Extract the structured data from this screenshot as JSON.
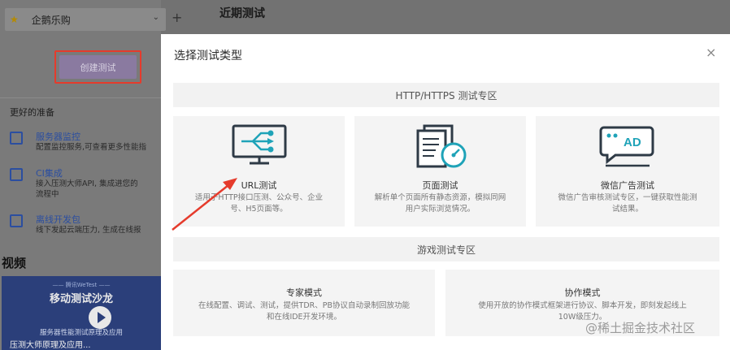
{
  "sidebar": {
    "project_name": "企鹅乐购",
    "create_button": "创建测试",
    "prep_title": "更好的准备",
    "tools": [
      {
        "title": "服务器监控",
        "desc": "配置监控服务,可查看更多性能指"
      },
      {
        "title": "CI集成",
        "desc_lines": [
          "接入压测大师API, 集成进您的",
          "流程中"
        ]
      },
      {
        "title": "离线开发包",
        "desc": "线下发起云端压力, 生成在线报"
      }
    ],
    "video_section_title": "视频",
    "video": {
      "top_caption": "——  腾讯WeTest  ——",
      "title": "移动测试沙龙",
      "caption": "服务器性能测试原理及应用",
      "bottom_text": "压测大师原理及应用..."
    }
  },
  "header": {
    "recent_title": "近期测试",
    "plus": "+"
  },
  "modal": {
    "title": "选择测试类型",
    "close": "×",
    "http_zone": "HTTP/HTTPS 测试专区",
    "game_zone": "游戏测试专区",
    "http_cards": [
      {
        "title": "URL测试",
        "desc_lines": [
          "适用于HTTP接口压测、公众号、企业",
          "号、H5页面等。"
        ]
      },
      {
        "title": "页面测试",
        "desc_lines": [
          "解析单个页面所有静态资源，模拟同网",
          "用户实际浏览情况。"
        ]
      },
      {
        "title": "微信广告测试",
        "desc_lines": [
          "微信广告审核测试专区，一键获取性能测",
          "试结果。"
        ]
      }
    ],
    "game_cards": [
      {
        "title": "专家模式",
        "desc_lines": [
          "在线配置、调试、测试，提供TDR、PB协议自动录制回放功能",
          "和在线IDE开发环境。"
        ]
      },
      {
        "title": "协作模式",
        "desc_lines": [
          "使用开放的协作模式框架进行协议、脚本开发，即刻发起线上",
          "10W级压力。"
        ]
      }
    ],
    "ad_icon_text": "AD"
  },
  "watermark": "@稀土掘金技术社区",
  "colors": {
    "accent_red": "#e53b2c",
    "icon_dark": "#2e3a46",
    "icon_teal": "#1fa3b8",
    "link_blue": "#2b4ea0"
  }
}
